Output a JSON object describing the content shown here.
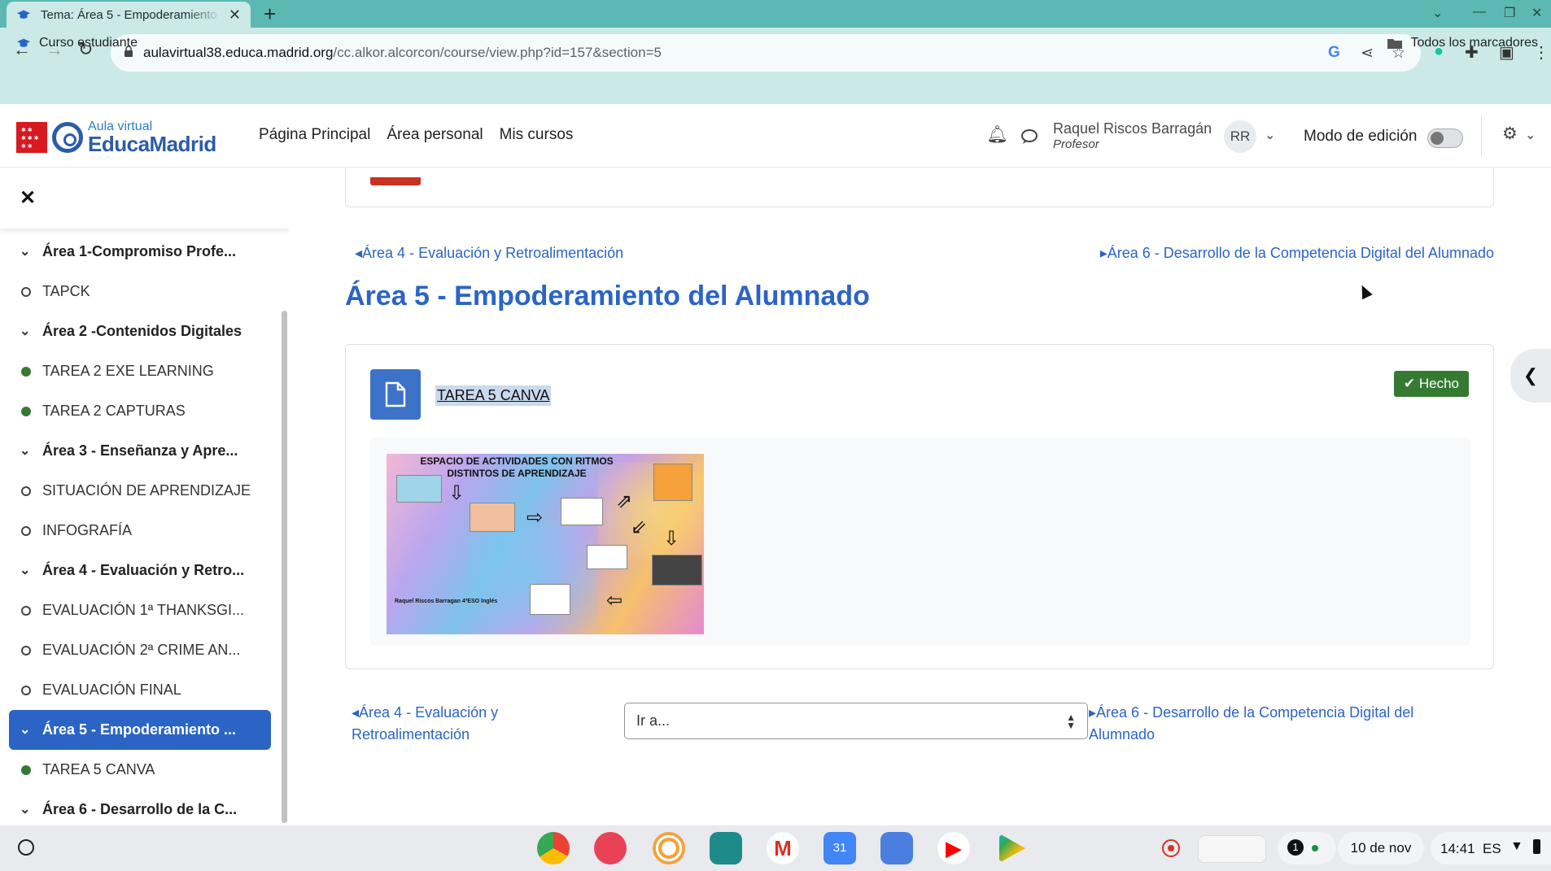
{
  "browser": {
    "tab_title": "Tema: Área 5 - Empoderamiento del Alumnado",
    "url_host": "aulavirtual38.educa.madrid.org",
    "url_path": "/cc.alkor.alcorcon/course/view.php?id=157&section=5",
    "bookmark_left": "Curso  estudiante",
    "bookmark_right": "Todos los marcadores"
  },
  "header": {
    "logo_small": "Aula virtual",
    "logo_big": "EducaMadrid",
    "nav": [
      "Página Principal",
      "Área personal",
      "Mis cursos"
    ],
    "user_name": "Raquel Riscos Barragán",
    "user_role": "Profesor",
    "avatar_initials": "RR",
    "edit_mode_label": "Modo de edición",
    "edit_mode_on": false
  },
  "drawer": {
    "items": [
      {
        "type": "section",
        "label": "Área 1-Compromiso Profe..."
      },
      {
        "type": "activity",
        "label": "TAPCK",
        "status": "todo"
      },
      {
        "type": "section",
        "label": "Área 2 -Contenidos Digitales"
      },
      {
        "type": "activity",
        "label": "TAREA 2 EXE LEARNING",
        "status": "done"
      },
      {
        "type": "activity",
        "label": "TAREA 2 CAPTURAS",
        "status": "done"
      },
      {
        "type": "section",
        "label": "Área 3 - Enseñanza y Apre..."
      },
      {
        "type": "activity",
        "label": "SITUACIÓN DE APRENDIZAJE",
        "status": "todo"
      },
      {
        "type": "activity",
        "label": "INFOGRAFÍA",
        "status": "todo"
      },
      {
        "type": "section",
        "label": "Área 4 - Evaluación y Retro..."
      },
      {
        "type": "activity",
        "label": "EVALUACIÓN 1ª THANKSGI...",
        "status": "todo"
      },
      {
        "type": "activity",
        "label": "EVALUACIÓN 2ª CRIME AN...",
        "status": "todo"
      },
      {
        "type": "activity",
        "label": "EVALUACIÓN FINAL",
        "status": "todo"
      },
      {
        "type": "section",
        "label": "Área 5 - Empoderamiento ...",
        "current": true
      },
      {
        "type": "activity",
        "label": "TAREA 5 CANVA",
        "status": "done"
      },
      {
        "type": "section",
        "label": "Área 6 - Desarrollo de la C..."
      }
    ]
  },
  "main": {
    "prev_link": "◂Área 4 - Evaluación y Retroalimentación",
    "next_link": "▸Área 6 - Desarrollo de la Competencia Digital del Alumnado",
    "section_title": "Área 5 - Empoderamiento del Alumnado",
    "activity_name": "TAREA 5 CANVA",
    "done_label": "Hecho",
    "canva_title": "ESPACIO DE ACTIVIDADES CON RITMOS DISTINTOS DE APRENDIZAJE",
    "canva_author": "Raquel Riscos Barragan 4ºESO Inglés",
    "bottom_prev": "◂Área 4 - Evaluación y Retroalimentación",
    "jump_placeholder": "Ir a...",
    "bottom_next": "▸Área 6 - Desarrollo de la Competencia Digital del Alumnado"
  },
  "shelf": {
    "notification_count": "1",
    "date": "10 de nov",
    "time": "14:41",
    "lang": "ES"
  },
  "colors": {
    "accent": "#2b64c4",
    "done": "#357a32",
    "browser_frame": "#5cb8b2",
    "browser_toolbar": "#cbe9e7"
  }
}
